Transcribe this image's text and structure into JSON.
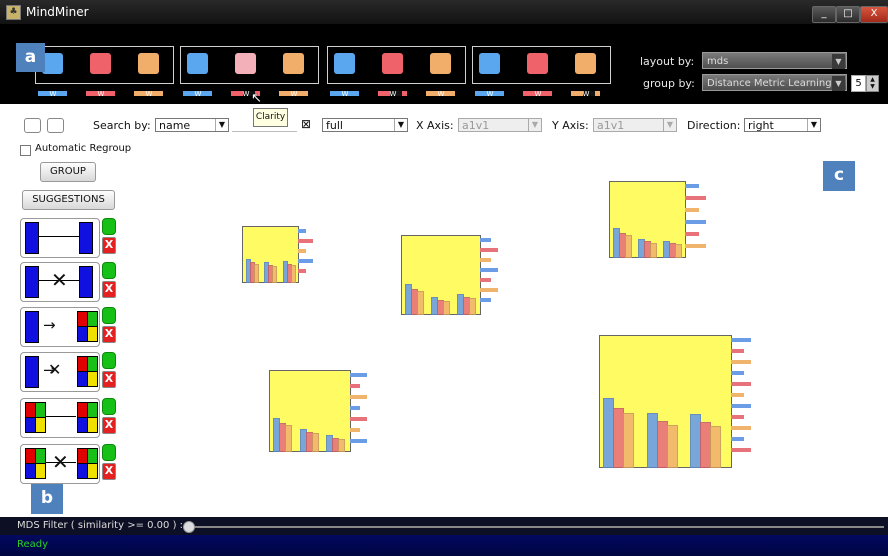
{
  "window": {
    "title": "MindMiner",
    "app_icon": "mindminer-app-icon",
    "controls": {
      "minimize": "_",
      "maximize": "□",
      "close": "X"
    }
  },
  "header": {
    "layout_label": "layout by:",
    "layout_value": "mds",
    "group_label": "group by:",
    "group_value": "Distance Metric Learning",
    "group_count": "5",
    "criteria_colors": [
      "#5aa7f0",
      "#f0626a",
      "#f0ae6a"
    ],
    "weight_label": "W",
    "tooltip": "Clarity"
  },
  "toolbar": {
    "search_label": "Search by:",
    "search_value": "name",
    "clear_icon": "clear-search-icon",
    "clear_glyph": "⊠",
    "mode_value": "full",
    "x_axis_label": "X Axis:",
    "x_axis_value": "a1v1",
    "y_axis_label": "Y Axis:",
    "y_axis_value": "a1v1",
    "direction_label": "Direction:",
    "direction_value": "right"
  },
  "left_panel": {
    "auto_regroup_label": "Automatic Regroup",
    "group_button": "GROUP",
    "suggestions_button": "SUGGESTIONS",
    "suggestion_icons": [
      "must-link-icon",
      "cannot-link-icon",
      "must-belong-icon",
      "cannot-belong-icon",
      "similar-groups-icon",
      "dissimilar-groups-icon"
    ],
    "reject_glyph": "X"
  },
  "labels": {
    "a": "a",
    "b": "b",
    "c": "c"
  },
  "footer": {
    "filter_label": "MDS Filter ( similarity >= 0.00 ) :",
    "status": "Ready"
  },
  "colors": {
    "glyph_fill": "#fffc63",
    "bar_red": "#e8727a",
    "bar_blue": "#6a9de6",
    "bar_orange": "#f0b46c",
    "accent_badge": "#4f81bd"
  }
}
